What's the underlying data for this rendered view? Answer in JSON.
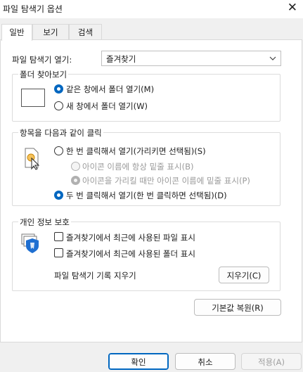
{
  "window": {
    "title": "파일 탐색기 옵션",
    "close_glyph": "✕"
  },
  "tabs": [
    {
      "label": "일반"
    },
    {
      "label": "보기"
    },
    {
      "label": "검색"
    }
  ],
  "open_explorer": {
    "label": "파일 탐색기 열기:",
    "value": "즐겨찾기"
  },
  "browse_folders": {
    "title": "폴더 찾아보기",
    "options": [
      {
        "label": "같은 창에서 폴더 열기(M)",
        "checked": true
      },
      {
        "label": "새 창에서 폴더 열기(W)",
        "checked": false
      }
    ]
  },
  "click_items": {
    "title": "항목을 다음과 같이 클릭",
    "single": {
      "label": "한 번 클릭해서 열기(가리키면 선택됨)(S)"
    },
    "underline_always": {
      "label": "아이콘 이름에 항상 밑줄 표시(B)"
    },
    "underline_hover": {
      "label": "아이콘을 가리킬 때만 아이콘 이름에 밑줄 표시(P)"
    },
    "double": {
      "label": "두 번 클릭해서 열기(한 번 클릭하면 선택됨)(D)"
    }
  },
  "privacy": {
    "title": "개인 정보 보호",
    "show_recent_files": "즐겨찾기에서 최근에 사용된 파일 표시",
    "show_recent_folders": "즐겨찾기에서 최근에 사용된 폴더 표시",
    "clear_history_label": "파일 탐색기 기록 지우기",
    "clear_button": "지우기(C)"
  },
  "restore_defaults": "기본값 복원(R)",
  "footer": {
    "ok": "확인",
    "cancel": "취소",
    "apply": "적용(A)"
  },
  "colors": {
    "accent": "#0067c0",
    "border": "#d9d9d9",
    "shield_blue": "#1f6fd1"
  }
}
